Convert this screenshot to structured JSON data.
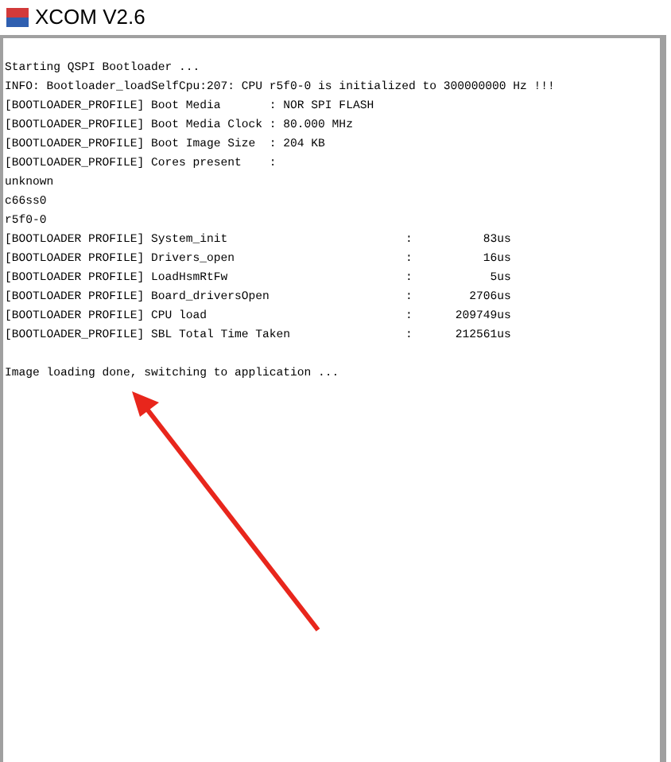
{
  "window": {
    "title": "XCOM V2.6"
  },
  "log": [
    {
      "kind": "text",
      "text": "Starting QSPI Bootloader ..."
    },
    {
      "kind": "text",
      "text": "INFO: Bootloader_loadSelfCpu:207: CPU r5f0-0 is initialized to 300000000 Hz !!!"
    },
    {
      "kind": "text",
      "text": "[BOOTLOADER_PROFILE] Boot Media       : NOR SPI FLASH"
    },
    {
      "kind": "text",
      "text": "[BOOTLOADER_PROFILE] Boot Media Clock : 80.000 MHz"
    },
    {
      "kind": "text",
      "text": "[BOOTLOADER_PROFILE] Boot Image Size  : 204 KB"
    },
    {
      "kind": "text",
      "text": "[BOOTLOADER_PROFILE] Cores present    :"
    },
    {
      "kind": "text",
      "text": "unknown"
    },
    {
      "kind": "text",
      "text": "c66ss0"
    },
    {
      "kind": "text",
      "text": "r5f0-0"
    },
    {
      "kind": "timing",
      "label": "[BOOTLOADER PROFILE] System_init",
      "colon": ":",
      "value": "83us"
    },
    {
      "kind": "timing",
      "label": "[BOOTLOADER PROFILE] Drivers_open",
      "colon": ":",
      "value": "16us"
    },
    {
      "kind": "timing",
      "label": "[BOOTLOADER PROFILE] LoadHsmRtFw",
      "colon": ":",
      "value": "5us"
    },
    {
      "kind": "timing",
      "label": "[BOOTLOADER PROFILE] Board_driversOpen",
      "colon": ":",
      "value": "2706us"
    },
    {
      "kind": "timing",
      "label": "[BOOTLOADER PROFILE] CPU load",
      "colon": ":",
      "value": "209749us"
    },
    {
      "kind": "timing",
      "label": "[BOOTLOADER_PROFILE] SBL Total Time Taken",
      "colon": ":",
      "value": "212561us"
    },
    {
      "kind": "blank"
    },
    {
      "kind": "text",
      "text": "Image loading done, switching to application ..."
    }
  ]
}
